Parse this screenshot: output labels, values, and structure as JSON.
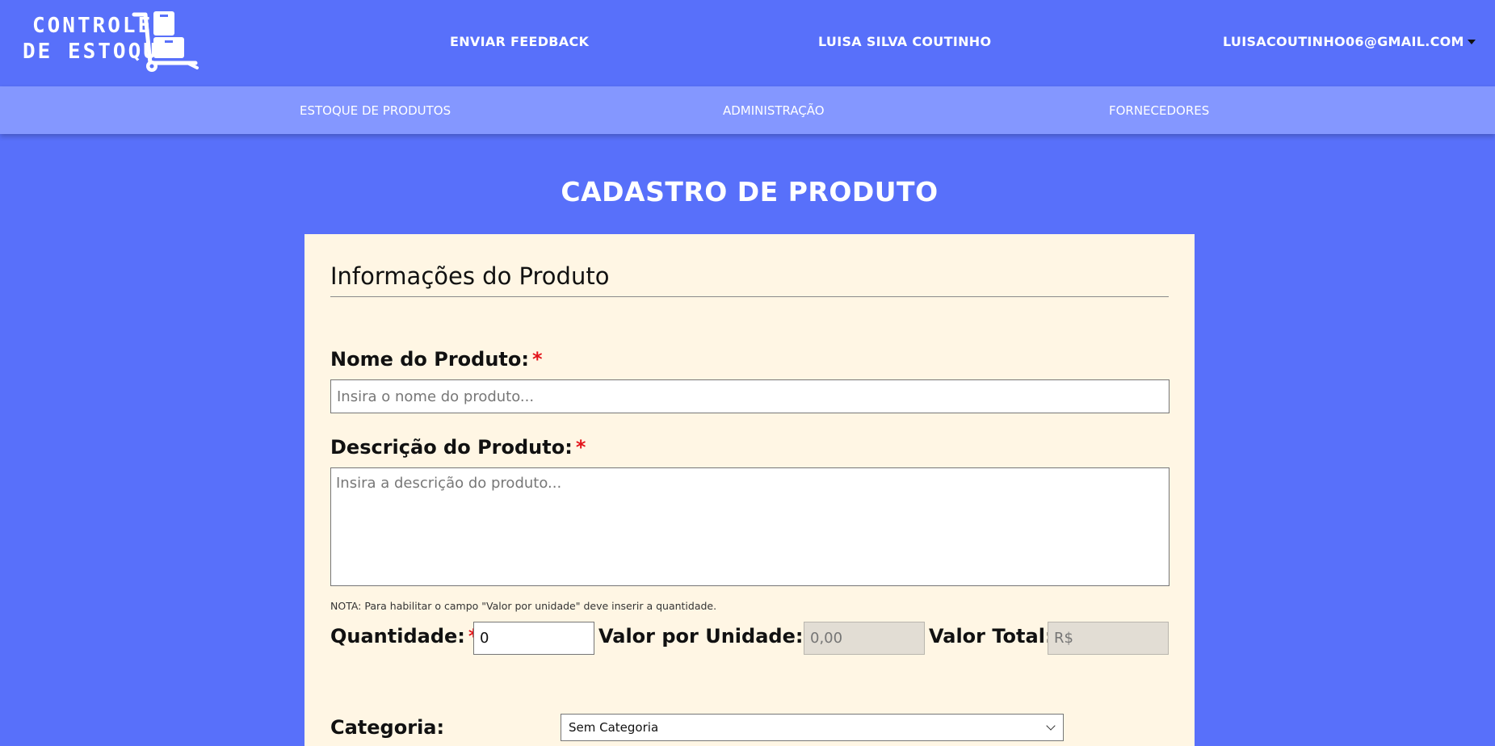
{
  "header": {
    "logo_line1": "CONTROLE",
    "logo_line2": "DE ESTOQUE",
    "logo_icon": "hand-truck-boxes-icon",
    "feedback_label": "ENVIAR FEEDBACK",
    "user_name": "LUISA SILVA COUTINHO",
    "user_email": "LUISACOUTINHO06@GMAIL.COM"
  },
  "nav": {
    "items": [
      {
        "label": "ESTOQUE DE PRODUTOS"
      },
      {
        "label": "ADMINISTRAÇÃO"
      },
      {
        "label": "FORNECEDORES"
      }
    ]
  },
  "page": {
    "title": "CADASTRO DE PRODUTO"
  },
  "form": {
    "section_title": "Informações do Produto",
    "required_marker": "*",
    "name": {
      "label": "Nome do Produto:",
      "placeholder": "Insira o nome do produto..."
    },
    "description": {
      "label": "Descrição do Produto:",
      "placeholder": "Insira a descrição do produto..."
    },
    "note": "NOTA: Para habilitar o campo \"Valor por unidade\" deve inserir a quantidade.",
    "quantity": {
      "label": "Quantidade:",
      "value": "0"
    },
    "unit_value": {
      "label": "Valor por Unidade:",
      "placeholder": "0,00"
    },
    "total_value": {
      "label": "Valor Total:",
      "placeholder": "R$"
    },
    "category": {
      "label": "Categoria:",
      "selected": "Sem Categoria"
    }
  },
  "colors": {
    "background": "#5870fa",
    "navbar": "#8497ff",
    "card": "#fff6e4",
    "required": "#e3141b",
    "disabled_input": "#e2ddd4"
  }
}
